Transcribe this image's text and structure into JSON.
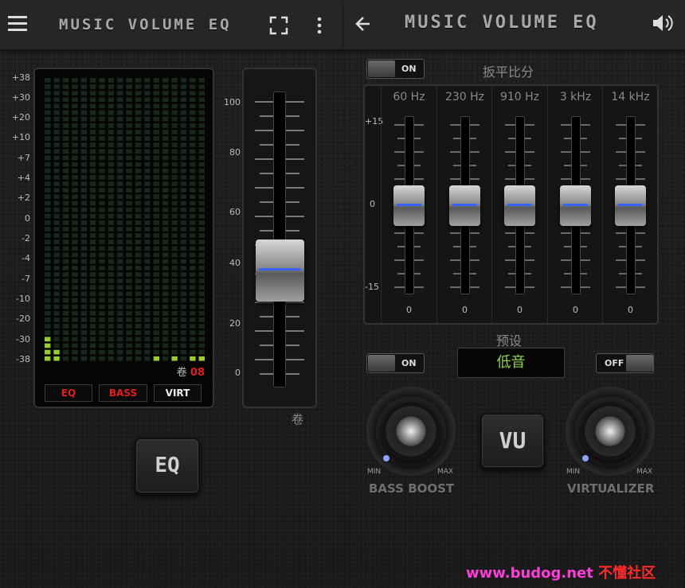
{
  "left_header": {
    "title": "MUSIC VOLUME EQ"
  },
  "right_header": {
    "title": "MUSIC VOLUME EQ"
  },
  "vu_meter": {
    "db_labels": [
      "+38",
      "+30",
      "+20",
      "+10",
      "+7",
      "+4",
      "+2",
      "0",
      "-2",
      "-4",
      "-7",
      "-10",
      "-20",
      "-30",
      "-38"
    ],
    "volume_prefix": "卷",
    "volume_value": "08",
    "tabs": [
      "EQ",
      "BASS",
      "VIRT"
    ]
  },
  "volume_slider": {
    "scale": [
      "100",
      "80",
      "60",
      "40",
      "20",
      "0"
    ],
    "label": "卷",
    "level": 0.5
  },
  "eq_button": {
    "label": "EQ"
  },
  "equalizer": {
    "toggle": "ON",
    "reset_label": "扳平比分",
    "scale_top": "+15",
    "scale_mid": "0",
    "scale_bottom": "-15",
    "bands": [
      {
        "freq": "60 Hz",
        "value": "0"
      },
      {
        "freq": "230 Hz",
        "value": "0"
      },
      {
        "freq": "910 Hz",
        "value": "0"
      },
      {
        "freq": "3 kHz",
        "value": "0"
      },
      {
        "freq": "14 kHz",
        "value": "0"
      }
    ]
  },
  "preset": {
    "label": "预设",
    "value": "低音"
  },
  "bass_boost": {
    "toggle": "ON",
    "min": "MIN",
    "max": "MAX",
    "label": "BASS BOOST"
  },
  "virtualizer": {
    "toggle": "OFF",
    "min": "MIN",
    "max": "MAX",
    "label": "VIRTUALIZER"
  },
  "vu_button": {
    "label": "VU"
  },
  "watermark": {
    "site": "www.budog.net",
    "name": "不懂社区"
  },
  "colors": {
    "accent_blue": "#3d63ff",
    "meter_green": "#9acd32",
    "alert_red": "#e02020",
    "preset_green": "#8fd14f"
  }
}
